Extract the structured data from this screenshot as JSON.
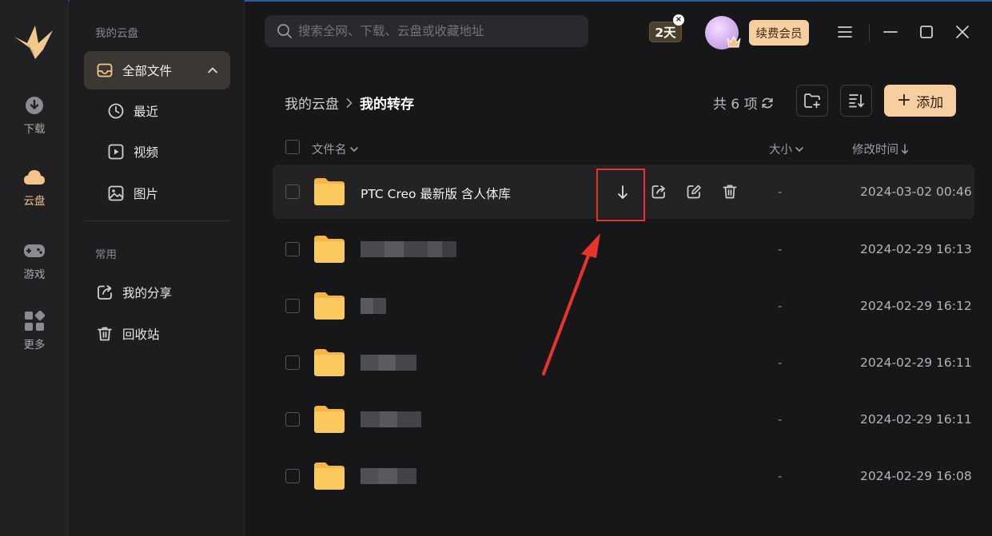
{
  "rail": {
    "items": [
      {
        "label": "下载",
        "icon": "download-icon"
      },
      {
        "label": "云盘",
        "icon": "cloud-icon",
        "active": true
      },
      {
        "label": "游戏",
        "icon": "gamepad-icon"
      },
      {
        "label": "更多",
        "icon": "grid-more-icon"
      }
    ]
  },
  "nav": {
    "section_cloud": "我的云盘",
    "all_files": "全部文件",
    "recent": "最近",
    "video": "视频",
    "image": "图片",
    "section_common": "常用",
    "my_share": "我的分享",
    "recycle": "回收站"
  },
  "topbar": {
    "search_placeholder": "搜索全网、下载、云盘或收藏地址",
    "days_badge": "2天",
    "badge_close": "×",
    "renew_label": "续费会员"
  },
  "content": {
    "breadcrumb_root": "我的云盘",
    "breadcrumb_sep": ">",
    "breadcrumb_current": "我的转存",
    "count_text": "共 6 项",
    "add_label": "添加"
  },
  "table": {
    "col_name": "文件名",
    "col_size": "大小",
    "col_modified": "修改时间",
    "rows": [
      {
        "name": "PTC Creo 最新版 含人体库",
        "size": "-",
        "modified": "2024-03-02 00:46"
      },
      {
        "name": "",
        "size": "-",
        "modified": "2024-02-29 16:13"
      },
      {
        "name": "",
        "size": "-",
        "modified": "2024-02-29 16:12"
      },
      {
        "name": "",
        "size": "-",
        "modified": "2024-02-29 16:11"
      },
      {
        "name": "",
        "size": "-",
        "modified": "2024-02-29 16:11"
      },
      {
        "name": "",
        "size": "-",
        "modified": "2024-02-29 16:08"
      }
    ]
  },
  "colors": {
    "accent": "#f6cea0",
    "highlight": "#e8342a",
    "folder": "#fcc25a"
  }
}
